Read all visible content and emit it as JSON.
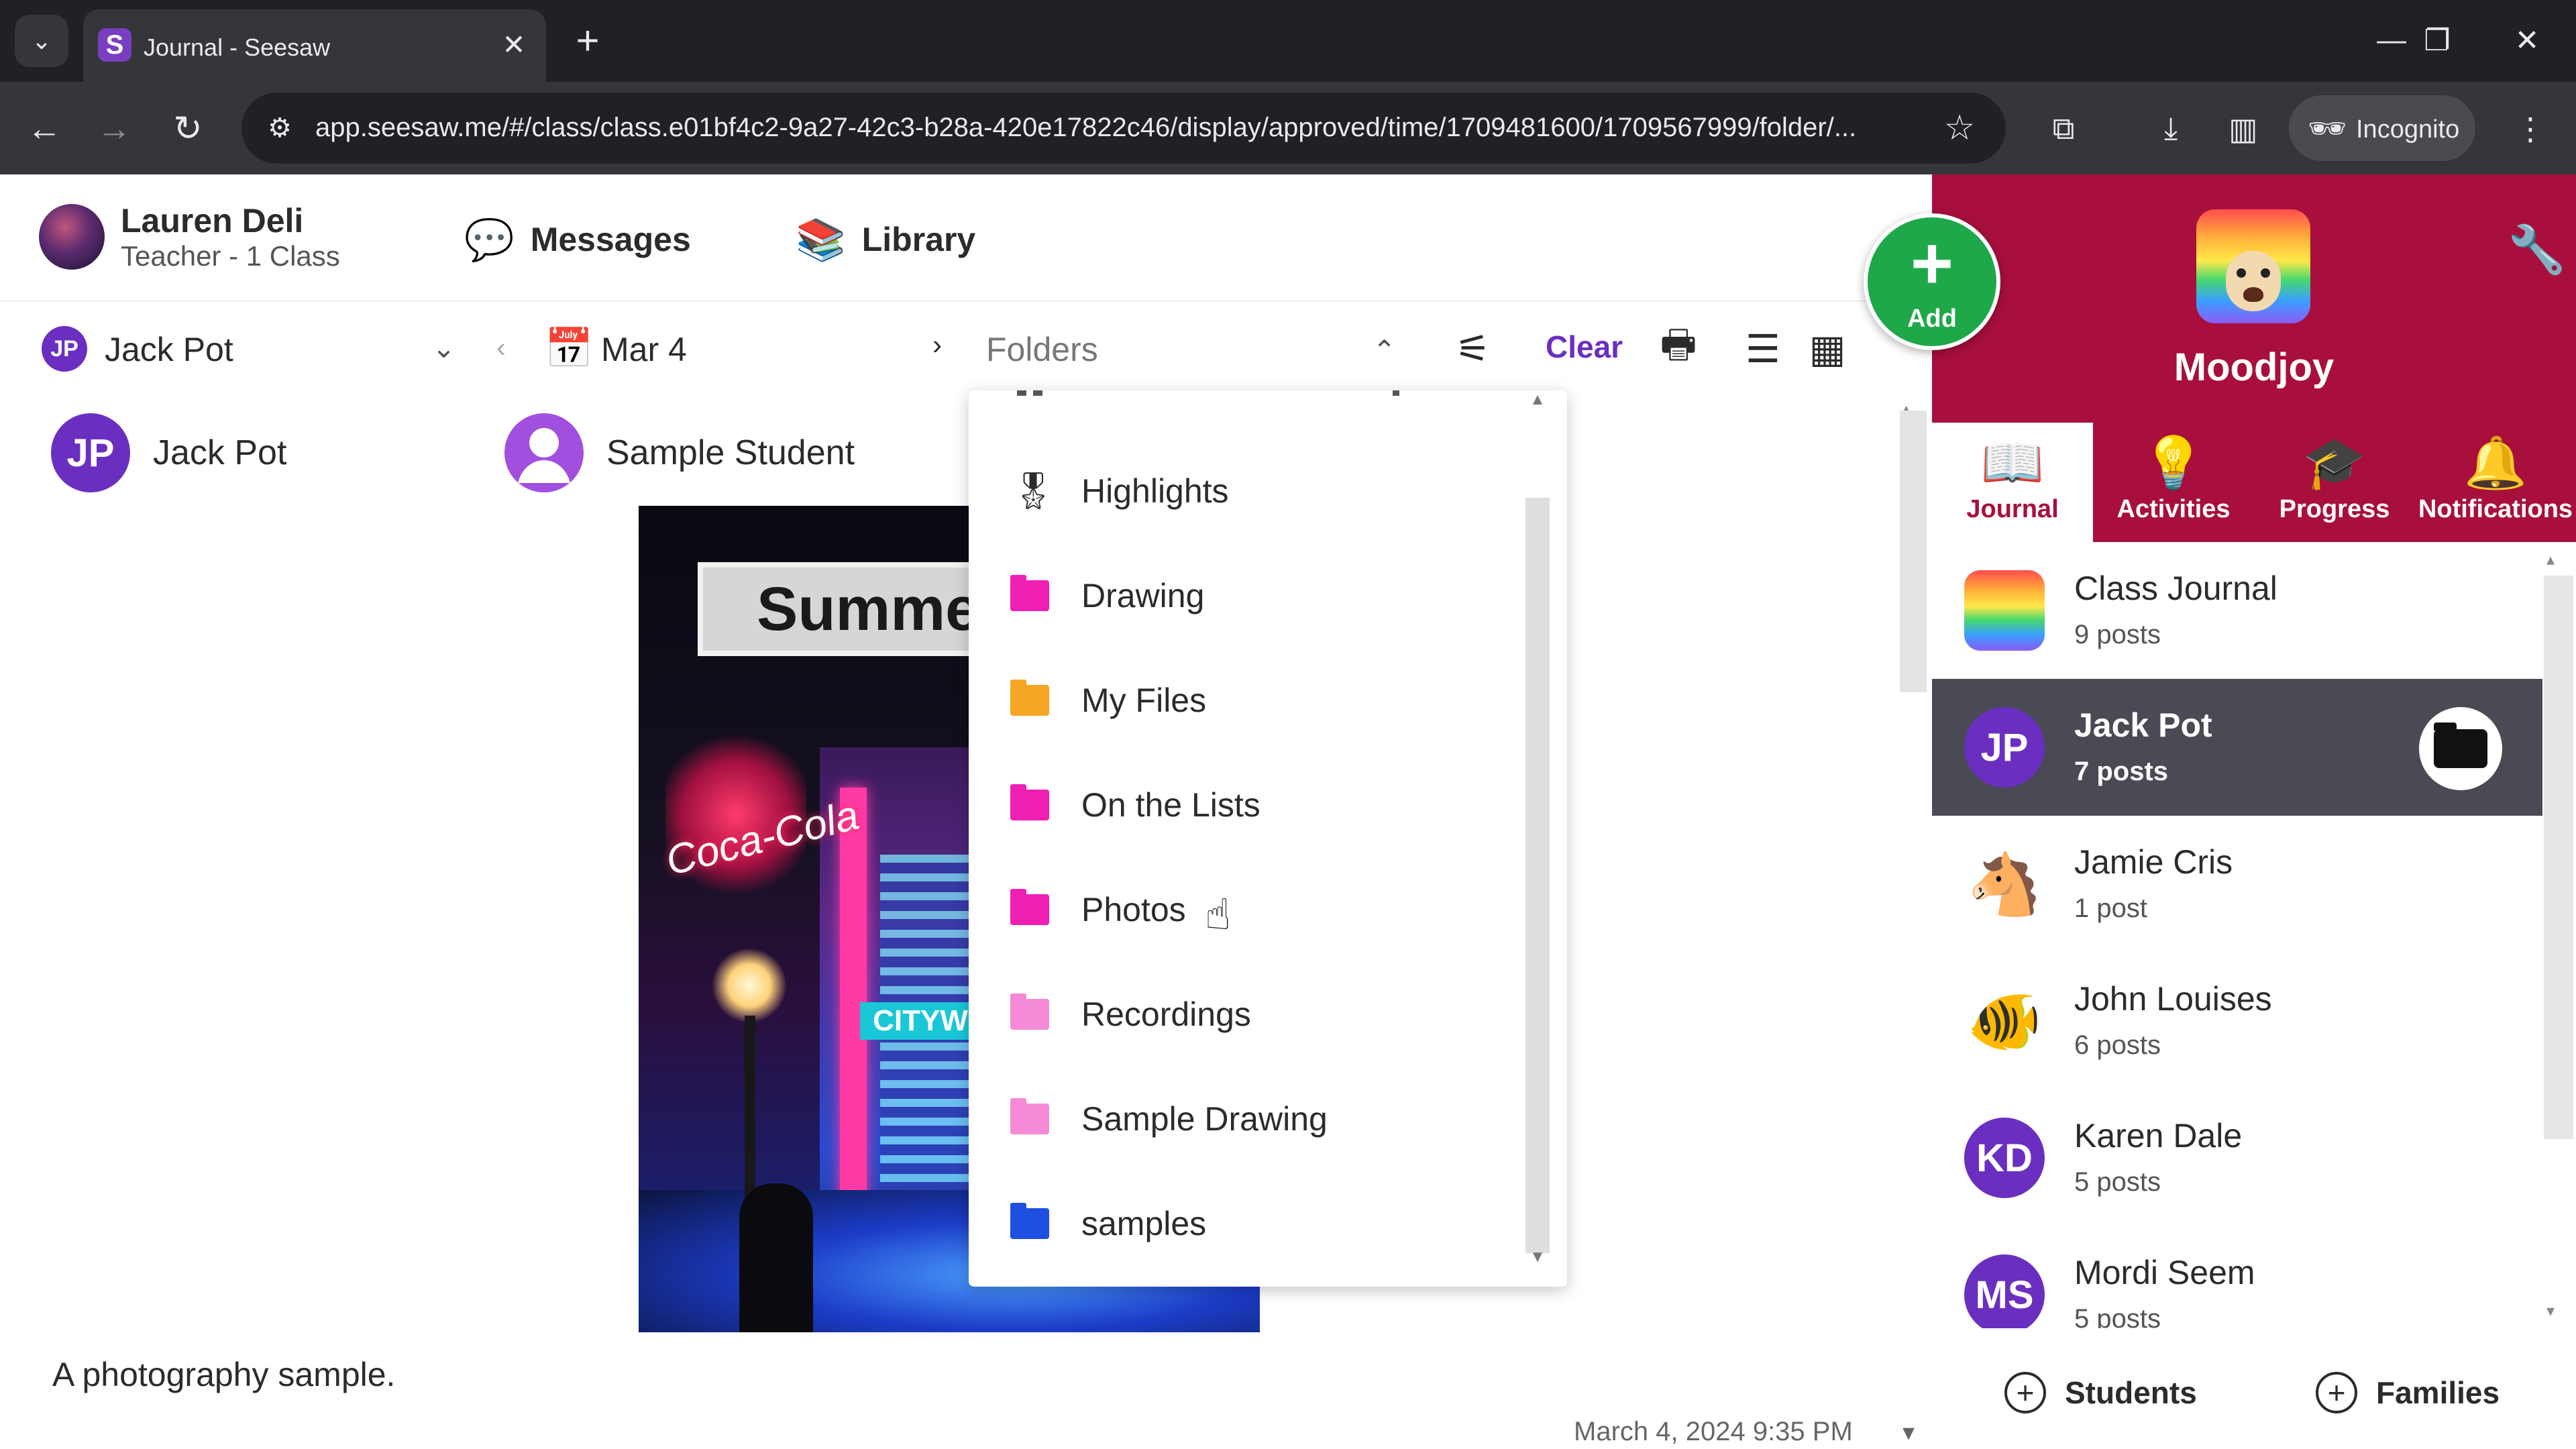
{
  "browser": {
    "tab_title": "Journal - Seesaw",
    "tab_favicon": "S",
    "url": "app.seesaw.me/#/class/class.e01bf4c2-9a27-42c3-b28a-420e17822c46/display/approved/time/1709481600/1709567999/folder/...",
    "incognito_label": "Incognito"
  },
  "header": {
    "user_name": "Lauren Deli",
    "user_role": "Teacher - 1 Class",
    "messages_label": "Messages",
    "library_label": "Library"
  },
  "filter": {
    "student_initials": "JP",
    "student_name": "Jack Pot",
    "date_label": "Mar 4",
    "folders_label": "Folders",
    "clear_label": "Clear"
  },
  "post": {
    "chip1_initials": "JP",
    "chip1_name": "Jack Pot",
    "chip2_name": "Sample Student",
    "image_sign_text": "Summe",
    "image_neon_text": "Coca-Cola",
    "image_city_text": "CITYW",
    "caption": "A photography sample.",
    "date": "March 4, 2024 9:35 PM"
  },
  "folders_dropdown": {
    "items": [
      {
        "label": "Highlights",
        "icon": "award-icon",
        "color": "#2b2b2b"
      },
      {
        "label": "Drawing",
        "icon": "folder-icon",
        "color": "#f01fb4"
      },
      {
        "label": "My Files",
        "icon": "folder-icon",
        "color": "#f5a623"
      },
      {
        "label": "On the Lists",
        "icon": "folder-icon",
        "color": "#f01fb4"
      },
      {
        "label": "Photos",
        "icon": "folder-icon",
        "color": "#f01fb4"
      },
      {
        "label": "Recordings",
        "icon": "folder-icon",
        "color": "#f58ad9"
      },
      {
        "label": "Sample Drawing",
        "icon": "folder-icon",
        "color": "#f58ad9"
      },
      {
        "label": "samples",
        "icon": "folder-icon",
        "color": "#1f4fe0"
      }
    ]
  },
  "sidebar": {
    "add_label": "Add",
    "class_name": "Moodjoy",
    "tabs": [
      {
        "label": "Journal",
        "icon": "book-icon"
      },
      {
        "label": "Activities",
        "icon": "lightbulb-icon"
      },
      {
        "label": "Progress",
        "icon": "graduation-cap-icon"
      },
      {
        "label": "Notifications",
        "icon": "bell-icon"
      }
    ],
    "items": [
      {
        "name": "Class Journal",
        "count": "9 posts",
        "initials": "",
        "color": "#ffffff"
      },
      {
        "name": "Jack Pot",
        "count": "7 posts",
        "initials": "JP",
        "color": "#6a2fc0"
      },
      {
        "name": "Jamie Cris",
        "count": "1 post",
        "initials": "",
        "color": "#ffffff"
      },
      {
        "name": "John Louises",
        "count": "6 posts",
        "initials": "",
        "color": "#ffffff"
      },
      {
        "name": "Karen Dale",
        "count": "5 posts",
        "initials": "KD",
        "color": "#6a2fc0"
      },
      {
        "name": "Mordi Seem",
        "count": "5 posts",
        "initials": "MS",
        "color": "#6a2fc0"
      }
    ],
    "students_label": "Students",
    "families_label": "Families"
  },
  "colors": {
    "brand_purple": "#6a2fc0",
    "class_red": "#a80f3c",
    "add_green": "#1fa84a"
  }
}
